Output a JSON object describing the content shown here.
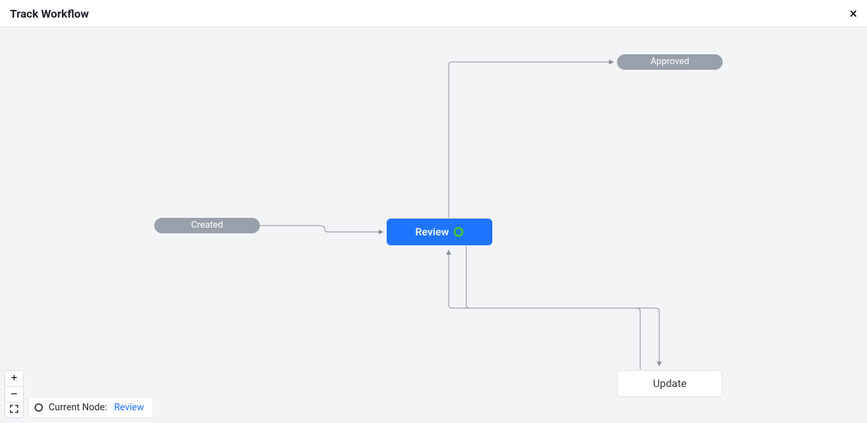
{
  "header": {
    "title": "Track Workflow"
  },
  "nodes": {
    "created": {
      "label": "Created"
    },
    "review": {
      "label": "Review",
      "current": true
    },
    "approved": {
      "label": "Approved"
    },
    "update": {
      "label": "Update"
    }
  },
  "status": {
    "label": "Current Node:",
    "value": "Review"
  },
  "zoom": {
    "in": "+",
    "out": "−"
  }
}
